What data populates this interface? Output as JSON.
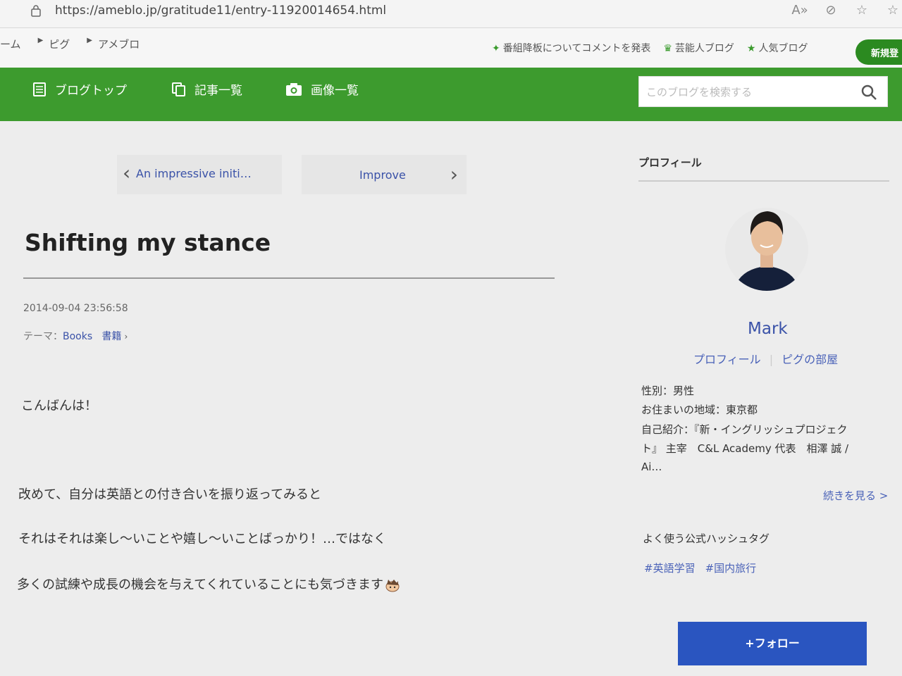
{
  "browser": {
    "url": "https://ameblo.jp/gratitude11/entry-11920014654.html",
    "icons": [
      "read-aloud-icon",
      "extension-icon",
      "favorite-icon",
      "favorites-bar-icon"
    ]
  },
  "topnav": {
    "breadcrumbs": [
      "ーム",
      "ピグ",
      "アメブロ"
    ],
    "links": [
      {
        "icon": "sparkle-icon",
        "label": "番組降板についてコメントを発表"
      },
      {
        "icon": "crown-icon",
        "label": "芸能人ブログ"
      },
      {
        "icon": "star-icon",
        "label": "人気ブログ"
      }
    ],
    "new_button": "新規登"
  },
  "blognav": {
    "tabs": [
      {
        "icon": "document-icon",
        "label": "ブログトップ"
      },
      {
        "icon": "copy-icon",
        "label": "記事一覧"
      },
      {
        "icon": "camera-icon",
        "label": "画像一覧"
      }
    ],
    "search_placeholder": "このブログを検索する"
  },
  "postnav": {
    "prev": "An impressive initi…",
    "next": "Improve"
  },
  "article": {
    "title": "Shifting my stance",
    "date": "2014-09-04 23:56:58",
    "theme_prefix": "テーマ：",
    "theme_tags": [
      "Books",
      "書籍"
    ],
    "paragraphs": [
      "こんばんは！",
      "改めて、自分は英語との付き合いを振り返ってみると",
      "それはそれは楽し～いことや嬉し～いことばっかり！…ではなく",
      "多くの試練や成長の機会を与えてくれていることにも気づきます"
    ]
  },
  "profile": {
    "heading": "プロフィール",
    "name": "Mark",
    "links": [
      "プロフィール",
      "ピグの部屋"
    ],
    "info": [
      "性別：男性",
      "お住まいの地域：東京都",
      "自己紹介：『新・イングリッシュプロジェク",
      "ト』 主宰　C&L Academy 代表　相澤 誠 /",
      "Ai…"
    ],
    "read_more": "続きを見る >",
    "hashtag_heading": "よく使う公式ハッシュタグ",
    "hashtags": [
      "#英語学習",
      "#国内旅行"
    ],
    "follow": "+フォロー"
  },
  "colors": {
    "green": "#3d9b2e",
    "link": "#3a52a8",
    "follow": "#2a55c0"
  }
}
